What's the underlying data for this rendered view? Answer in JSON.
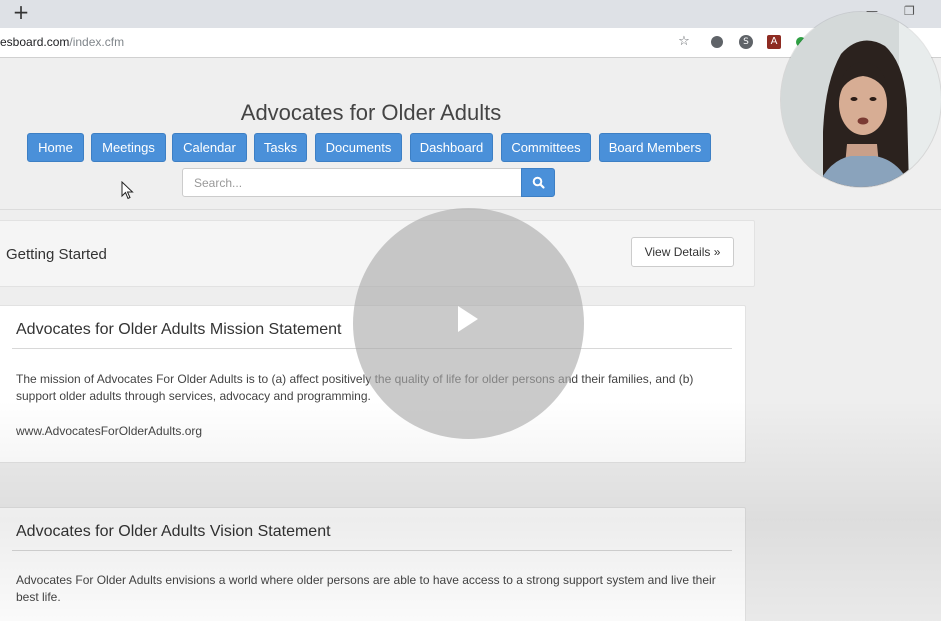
{
  "browser": {
    "new_tab_label": "+",
    "minimize_label": "—",
    "restore_label": "❐",
    "url_domain": "esboard.com",
    "url_path": "/index.cfm",
    "icons": [
      "star-icon",
      "extension-icon",
      "skype-icon",
      "pdf-icon",
      "evernote-icon"
    ]
  },
  "site": {
    "title": "Advocates for Older Adults",
    "accent_color": "#4a90d9"
  },
  "nav": {
    "home": "Home",
    "meetings": "Meetings",
    "calendar": "Calendar",
    "tasks": "Tasks",
    "documents": "Documents",
    "dashboard": "Dashboard",
    "committees": "Committees",
    "board_members": "Board Members"
  },
  "search": {
    "placeholder": "Search..."
  },
  "getting_started": {
    "title": "Getting Started",
    "button_label": "View Details »"
  },
  "mission": {
    "title": "Advocates for Older Adults Mission Statement",
    "body": "The mission of Advocates For Older Adults is to (a) affect positively the quality of life for older persons and their families, and (b) support older adults through services, advocacy and programming.",
    "link": "www.AdvocatesForOlderAdults.org"
  },
  "vision": {
    "title": "Advocates for Older Adults Vision Statement",
    "body": "Advocates For Older Adults envisions a world where older persons are able to have access to a strong support system and live their best life."
  }
}
